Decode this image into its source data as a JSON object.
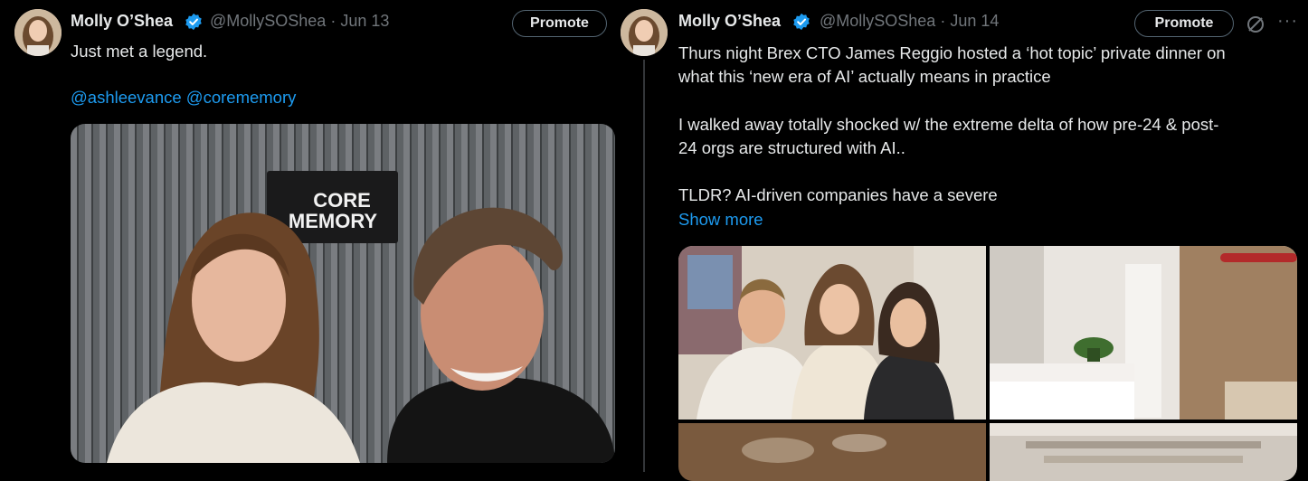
{
  "tweets": [
    {
      "author_name": "Molly O’Shea",
      "handle_date": "@MollySOShea · Jun 13",
      "promote_label": "Promote",
      "lines": [
        "Just met a legend."
      ],
      "mentions": "@ashleevance @corememory",
      "photo_sign": {
        "line1": "CORE",
        "line2": "MEMORY"
      }
    },
    {
      "author_name": "Molly O’Shea",
      "handle_date": "@MollySOShea · Jun 14",
      "promote_label": "Promote",
      "lines": [
        "Thurs night Brex CTO James Reggio hosted a ‘hot topic’ private dinner on",
        "what this ‘new era of AI’ actually means in practice",
        "I walked away totally shocked w/ the extreme delta of how pre-24 & post-",
        "24 orgs are structured with AI..",
        "TLDR? AI-driven companies have a severe"
      ],
      "show_more": "Show more"
    }
  ],
  "icons": [
    "verified-badge-icon",
    "analytics-icon",
    "more-icon"
  ],
  "colors": {
    "background": "#000000",
    "text": "#e7e9ea",
    "muted": "#71767b",
    "link": "#1d9bf0",
    "verified": "#1d9bf0"
  }
}
